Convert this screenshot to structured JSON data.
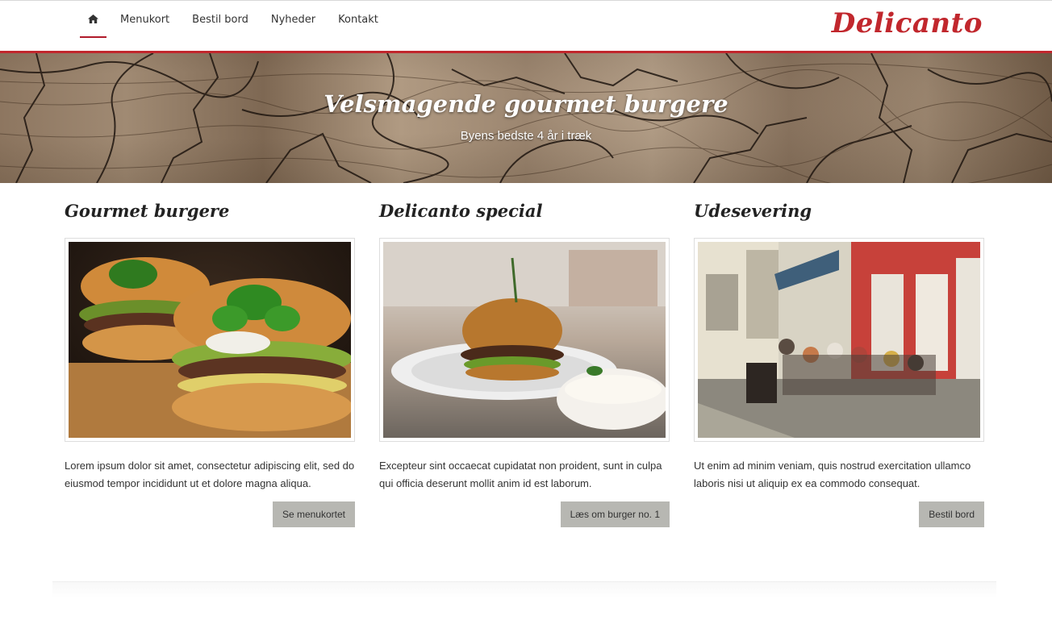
{
  "nav": {
    "home_icon": "home-icon",
    "items": [
      {
        "label": "Menukort"
      },
      {
        "label": "Bestil bord"
      },
      {
        "label": "Nyheder"
      },
      {
        "label": "Kontakt"
      }
    ],
    "brand": "Delicanto"
  },
  "hero": {
    "title": "Velsmagende gourmet burgere",
    "subtitle": "Byens bedste 4 år i træk"
  },
  "columns": [
    {
      "title": "Gourmet burgere",
      "text": "Lorem ipsum dolor sit amet, consectetur adipiscing elit, sed do eiusmod tempor incididunt ut et dolore magna aliqua.",
      "button": "Se menukortet"
    },
    {
      "title": "Delicanto special",
      "text": "Excepteur sint occaecat cupidatat non proident, sunt in culpa qui officia deserunt mollit anim id est laborum.",
      "button": "Læs om burger no. 1"
    },
    {
      "title": "Udesevering",
      "text": "Ut enim ad minim veniam, quis nostrud exercitation ullamco laboris nisi ut aliquip ex ea commodo consequat.",
      "button": "Bestil bord"
    }
  ],
  "colors": {
    "accent": "#c1272d",
    "button_bg": "#b7b7b2"
  }
}
